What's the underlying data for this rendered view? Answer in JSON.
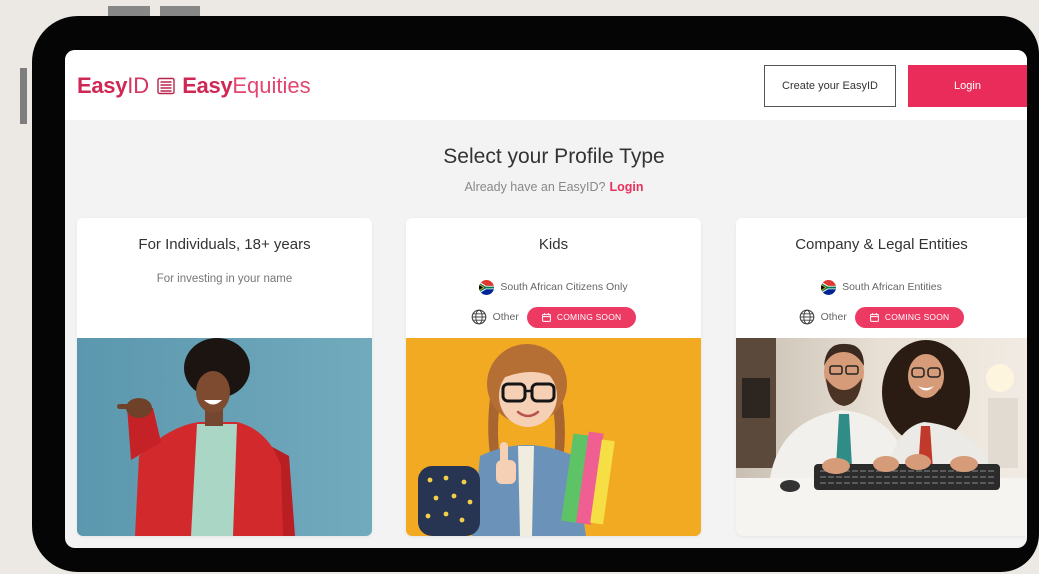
{
  "header": {
    "logo_primary_bold": "Easy",
    "logo_primary_light": "ID",
    "logo_icon": "abacus-icon",
    "logo_secondary_bold": "Easy",
    "logo_secondary_light": "Equities",
    "create_button_label": "Create your EasyID",
    "login_button_label": "Login"
  },
  "main": {
    "title": "Select your Profile Type",
    "subtitle_text": "Already have an EasyID?",
    "subtitle_link": "Login"
  },
  "cards": [
    {
      "title": "For Individuals, 18+ years",
      "description": "For investing in your name"
    },
    {
      "title": "Kids",
      "options": [
        {
          "icon": "south-africa-flag-icon",
          "label": "South African Citizens Only"
        },
        {
          "icon": "globe-icon",
          "label": "Other",
          "badge_icon": "calendar-icon",
          "badge": "COMING SOON"
        }
      ]
    },
    {
      "title": "Company & Legal Entities",
      "options": [
        {
          "icon": "south-africa-flag-icon",
          "label": "South African Entities"
        },
        {
          "icon": "globe-icon",
          "label": "Other",
          "badge_icon": "calendar-icon",
          "badge": "COMING SOON"
        }
      ]
    }
  ],
  "colors": {
    "brand_pink": "#ea2c5a",
    "logo_crimson": "#cf2855",
    "logo_light_pink": "#e2466f",
    "badge_pink": "#ec3a63",
    "device_frame": "#050505",
    "page_background": "#ece9e4",
    "screen_background": "#f3f3f3"
  }
}
